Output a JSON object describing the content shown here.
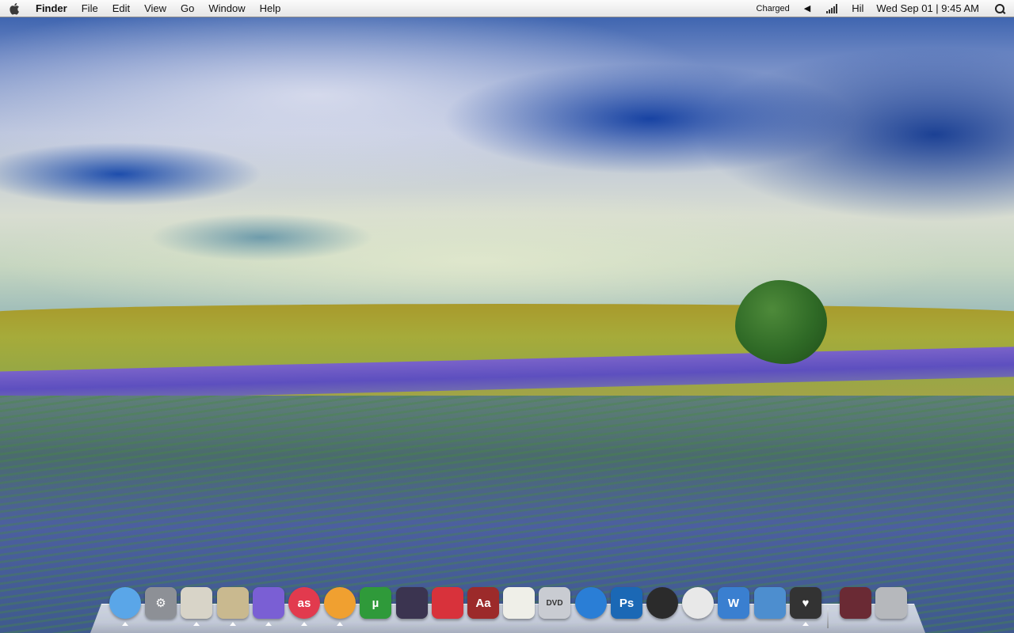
{
  "menubar": {
    "apple_icon": "apple-logo-icon",
    "app_name": "Finder",
    "menus": [
      "File",
      "Edit",
      "View",
      "Go",
      "Window",
      "Help"
    ],
    "battery_status": "Charged",
    "volume_icon": "speaker-icon",
    "signal_icon": "wifi-signal-icon",
    "user": "Hil",
    "datetime": "Wed Sep 01 | 9:45 AM",
    "spotlight_icon": "spotlight-search-icon"
  },
  "dock": {
    "items": [
      {
        "name": "adium-icon",
        "color": "#5aa6e8",
        "label": "",
        "running": true
      },
      {
        "name": "system-preferences-icon",
        "color": "#8d9096",
        "label": "⚙",
        "running": false
      },
      {
        "name": "preview-icon",
        "color": "#d8d4c8",
        "label": "",
        "running": true
      },
      {
        "name": "stamps-icon",
        "color": "#c9b98f",
        "label": "",
        "running": true
      },
      {
        "name": "music-robot-icon",
        "color": "#7a5fd4",
        "label": "",
        "running": true
      },
      {
        "name": "lastfm-icon",
        "color": "#e23a4e",
        "label": "as",
        "running": true
      },
      {
        "name": "firefox-icon",
        "color": "#f0a030",
        "label": "",
        "running": true
      },
      {
        "name": "utorrent-icon",
        "color": "#2f9a3a",
        "label": "µ",
        "running": false
      },
      {
        "name": "photo-booth-icon",
        "color": "#3b3450",
        "label": "",
        "running": false
      },
      {
        "name": "gift-icon",
        "color": "#d8323b",
        "label": "",
        "running": false
      },
      {
        "name": "dictionary-icon",
        "color": "#9c2a2a",
        "label": "Aa",
        "running": false
      },
      {
        "name": "textedit-icon",
        "color": "#efefe8",
        "label": "",
        "running": false
      },
      {
        "name": "dvd-player-icon",
        "color": "#c9ccd2",
        "label": "DVD",
        "running": false
      },
      {
        "name": "vpn-shield-icon",
        "color": "#2a7ed6",
        "label": "",
        "running": false
      },
      {
        "name": "photoshop-icon",
        "color": "#1b68b5",
        "label": "Ps",
        "running": false
      },
      {
        "name": "camino-icon",
        "color": "#2b2b2b",
        "label": "",
        "running": false
      },
      {
        "name": "sheep-icon",
        "color": "#e8e8e8",
        "label": "",
        "running": false
      },
      {
        "name": "word-icon",
        "color": "#3a7fd0",
        "label": "W",
        "running": false
      },
      {
        "name": "migration-icon",
        "color": "#4d8ecf",
        "label": "",
        "running": false
      },
      {
        "name": "black-box-icon",
        "color": "#333333",
        "label": "♥",
        "running": true
      },
      {
        "name": "downloads-stack-icon",
        "color": "#6a2a34",
        "label": "",
        "running": false
      },
      {
        "name": "trash-icon",
        "color": "#b6b8bc",
        "label": "",
        "running": false
      }
    ]
  }
}
